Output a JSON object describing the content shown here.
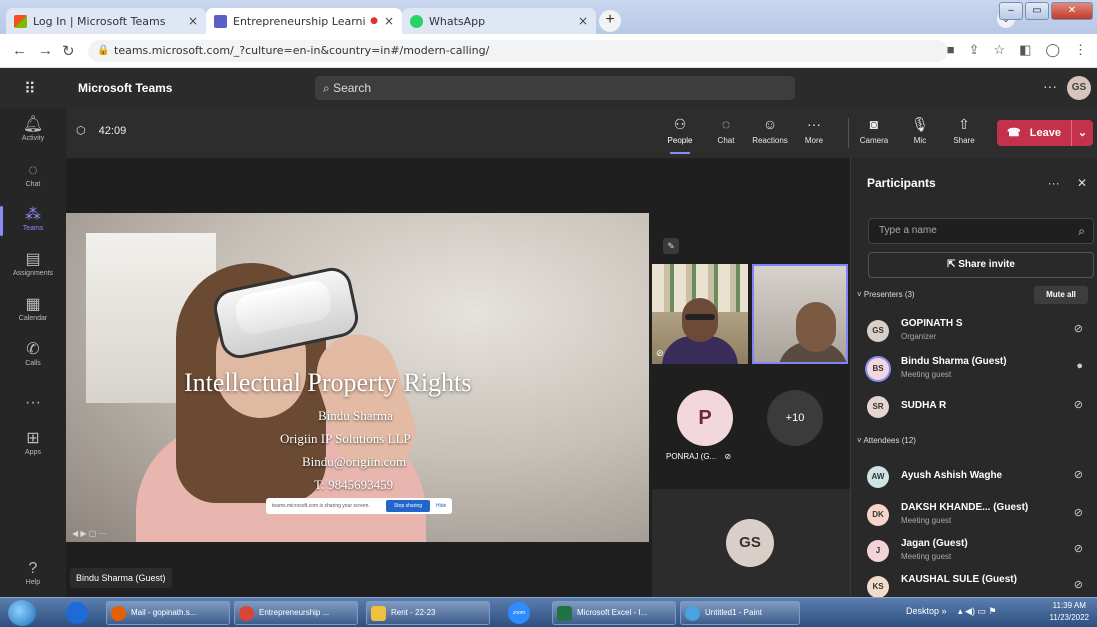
{
  "browser": {
    "tabs": [
      {
        "label": "Log In | Microsoft Teams",
        "close": "×"
      },
      {
        "label": "Entrepreneurship Learning S",
        "close": "×"
      },
      {
        "label": "WhatsApp",
        "close": "×"
      }
    ],
    "new_tab": "+",
    "url": "teams.microsoft.com/_?culture=en-in&country=in#/modern-calling/"
  },
  "teams": {
    "brand": "Microsoft Teams",
    "search_label": "Search",
    "avatar": "GS"
  },
  "rail": [
    {
      "label": "Activity",
      "icon": "bell-icon"
    },
    {
      "label": "Chat",
      "icon": "chat-icon"
    },
    {
      "label": "Teams",
      "icon": "teams-icon"
    },
    {
      "label": "Assignments",
      "icon": "assignments-icon"
    },
    {
      "label": "Calendar",
      "icon": "calendar-icon"
    },
    {
      "label": "Calls",
      "icon": "phone-icon"
    },
    {
      "label": "Apps",
      "icon": "apps-icon"
    },
    {
      "label": "Help",
      "icon": "help-icon"
    }
  ],
  "meeting": {
    "timer": "42:09",
    "toolbar": [
      {
        "label": "People",
        "icon": "people-icon"
      },
      {
        "label": "Chat",
        "icon": "chat-icon"
      },
      {
        "label": "Reactions",
        "icon": "reactions-icon"
      },
      {
        "label": "More",
        "icon": "more-icon"
      },
      {
        "label": "Camera",
        "icon": "camera-off-icon"
      },
      {
        "label": "Mic",
        "icon": "mic-off-icon"
      },
      {
        "label": "Share",
        "icon": "share-icon"
      }
    ],
    "leave_label": "Leave",
    "accent": "#8b8cf2",
    "leave_color": "#c4314b"
  },
  "slide": {
    "title": "Intellectual Property Rights",
    "lines": [
      "Bindu Sharma",
      "Origiin IP Solutions LLP",
      "Bindu@origiin.com",
      "T: 9845693459"
    ],
    "share_notice": "teams.microsoft.com is sharing your screen.",
    "stop_sharing": "Stop sharing",
    "hide": "Hide"
  },
  "presenter_name": "Bindu Sharma (Guest)",
  "gallery": {
    "p_initial": "P",
    "more_count": "+10",
    "ponraj_label": "PONRAJ (G...",
    "gs_initials": "GS"
  },
  "participants": {
    "title": "Participants",
    "search_placeholder": "Type a name",
    "share_invite": "Share invite",
    "presenters_header": "Presenters (3)",
    "mute_all": "Mute all",
    "attendees_header": "Attendees (12)",
    "presenters": [
      {
        "initials": "GS",
        "name": "GOPINATH S",
        "role": "Organizer",
        "color": "#d9cfc8"
      },
      {
        "initials": "BS",
        "name": "Bindu Sharma (Guest)",
        "role": "Meeting guest",
        "color": "#f2d7dc"
      },
      {
        "initials": "SR",
        "name": "SUDHA R",
        "role": "",
        "color": "#e4d6cf"
      }
    ],
    "attendees": [
      {
        "initials": "AW",
        "name": "Ayush Ashish Waghe",
        "role": "",
        "color": "#cfe3e6"
      },
      {
        "initials": "DK",
        "name": "DAKSH KHANDE... (Guest)",
        "role": "Meeting guest",
        "color": "#f6d4c9"
      },
      {
        "initials": "J",
        "name": "Jagan (Guest)",
        "role": "Meeting guest",
        "color": "#f3d2d8"
      },
      {
        "initials": "KS",
        "name": "KAUSHAL SULE (Guest)",
        "role": "",
        "color": "#f1dcc9"
      }
    ]
  },
  "taskbar": {
    "items": [
      "Mail - gopinath.s...",
      "Entrepreneurship ...",
      "Rent - 22-23",
      "Microsoft Excel - I...",
      "Untitled1 - Paint"
    ],
    "zoom_label": "zoom",
    "desktop": "Desktop",
    "time": "11:39 AM",
    "date": "11/23/2022"
  }
}
